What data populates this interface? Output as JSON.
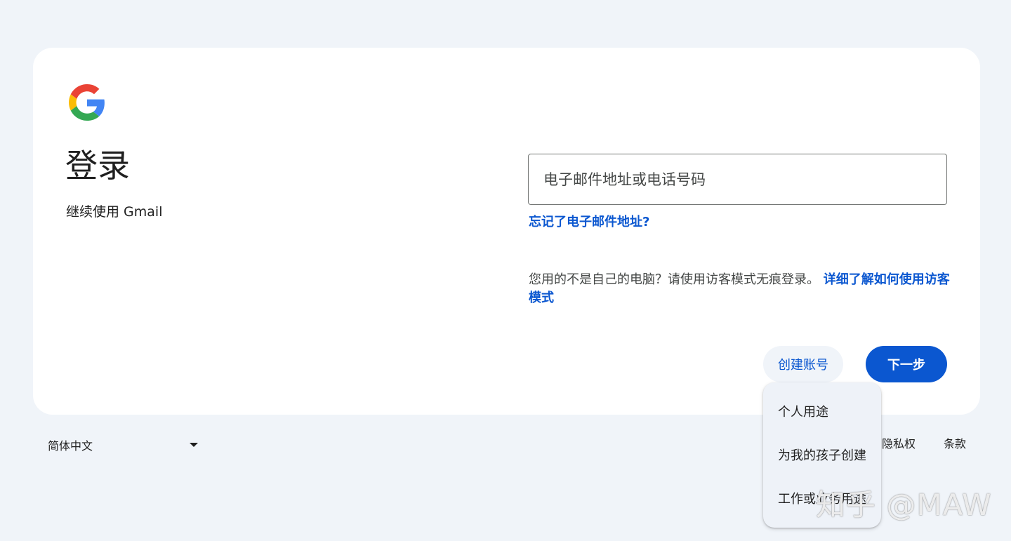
{
  "colors": {
    "background": "#f0f4f9",
    "card": "#ffffff",
    "accent": "#0b57d0",
    "text": "#1f1f1f"
  },
  "header": {
    "logo_icon": "google-g-icon",
    "title": "登录",
    "subtitle": "继续使用 Gmail"
  },
  "login": {
    "identifier_placeholder": "电子邮件地址或电话号码",
    "identifier_value": "",
    "forgot_email_link": "忘记了电子邮件地址?",
    "guest_text": "您用的不是自己的电脑？请使用访客模式无痕登录。",
    "guest_link": "详细了解如何使用访客模式"
  },
  "actions": {
    "create_account": "创建账号",
    "next": "下一步"
  },
  "create_menu": {
    "items": [
      "个人用途",
      "为我的孩子创建",
      "工作或业务用途"
    ]
  },
  "footer": {
    "language": "简体中文",
    "privacy": "隐私权",
    "terms": "条款"
  },
  "watermark": "知乎 @MAW"
}
